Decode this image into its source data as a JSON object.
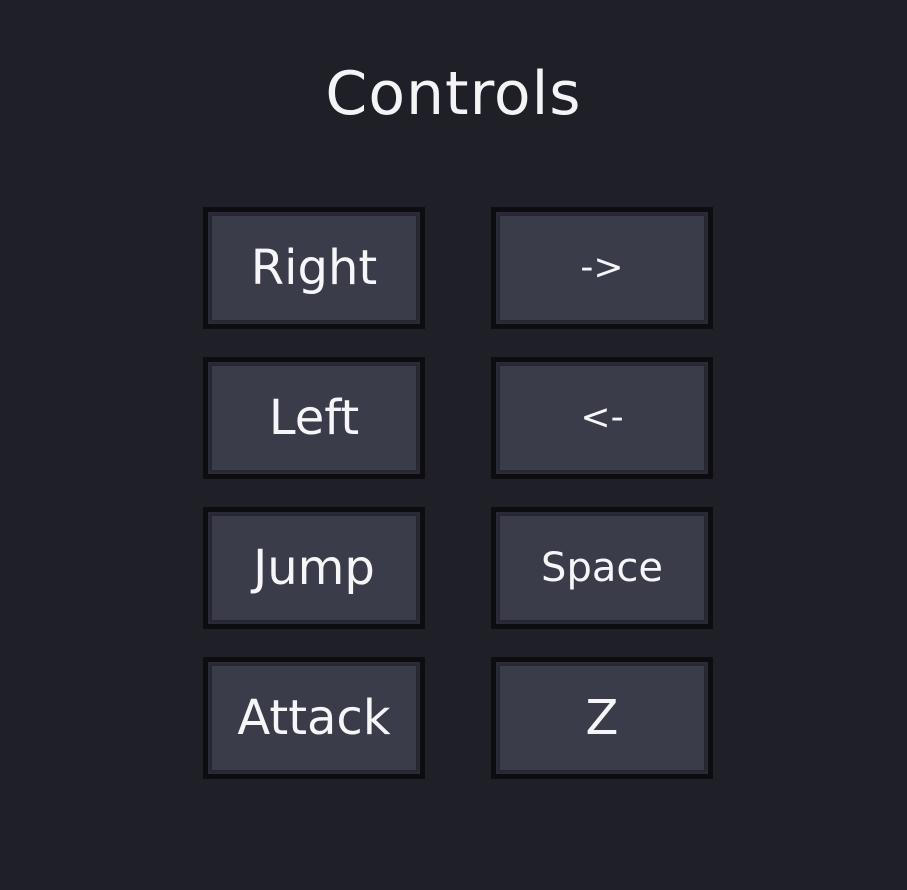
{
  "screen": {
    "title": "Controls"
  },
  "controls": [
    {
      "action": "Right",
      "key": "->"
    },
    {
      "action": "Left",
      "key": "<-"
    },
    {
      "action": "Jump",
      "key": "Space"
    },
    {
      "action": "Attack",
      "key": "Z"
    }
  ],
  "colors": {
    "background": "#1f1f27",
    "panel": "#3b3c4a",
    "panel_border": "#0d0d11",
    "text": "#f4f4f6"
  }
}
